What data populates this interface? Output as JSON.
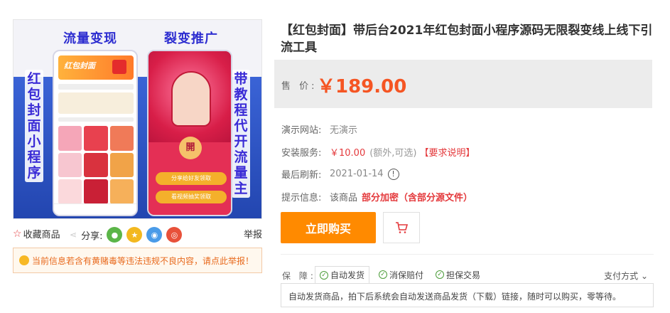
{
  "gallery": {
    "headline_left": "流量变现",
    "headline_right": "裂变推广",
    "side_left": [
      "红",
      "包",
      "封",
      "面",
      "小",
      "程",
      "序"
    ],
    "side_right": [
      "带",
      "教",
      "程",
      "代",
      "开",
      "流",
      "量",
      "主"
    ],
    "phone2_seal": "開",
    "phone2_btn1": "分享给好友领取",
    "phone2_btn2": "看视频抽奖领取"
  },
  "sharebar": {
    "favorite": "收藏商品",
    "share": "分享:",
    "report": "举报",
    "icons": [
      "wechat-icon",
      "qzone-icon",
      "qq-icon",
      "weibo-icon"
    ],
    "icon_colors": [
      "#5bb548",
      "#f3b81f",
      "#4a9be8",
      "#e8513a"
    ]
  },
  "notice": "当前信息若含有黄赌毒等违法违规不良内容，请点此举报！",
  "product": {
    "title": "【红包封面】带后台2021年红包封面小程序源码无限裂变线上线下引流工具",
    "price_label": "售 价:",
    "price": "￥189.00"
  },
  "info": {
    "demo_label": "演示网站:",
    "demo_value": "无演示",
    "install_label": "安装服务:",
    "install_price": "￥10.00",
    "install_note": "(额外,可选)",
    "install_req": "【要求说明】",
    "refresh_label": "最后刷新:",
    "refresh_value": "2021-01-14",
    "tip_label": "提示信息:",
    "tip_prefix": "该商品",
    "tip_bold": "部分加密（含部分源文件）"
  },
  "actions": {
    "buy": "立即购买"
  },
  "guarantee": {
    "label": "保 障:",
    "tags": [
      "自动发货",
      "消保赔付",
      "担保交易"
    ],
    "pay": "支付方式",
    "desc": "自动发货商品，拍下后系统会自动发送商品发货（下载）链接，随时可以购买，零等待。"
  },
  "colors": {
    "accent": "#ff8a00",
    "price": "#f55523",
    "warning": "#e8691c"
  }
}
